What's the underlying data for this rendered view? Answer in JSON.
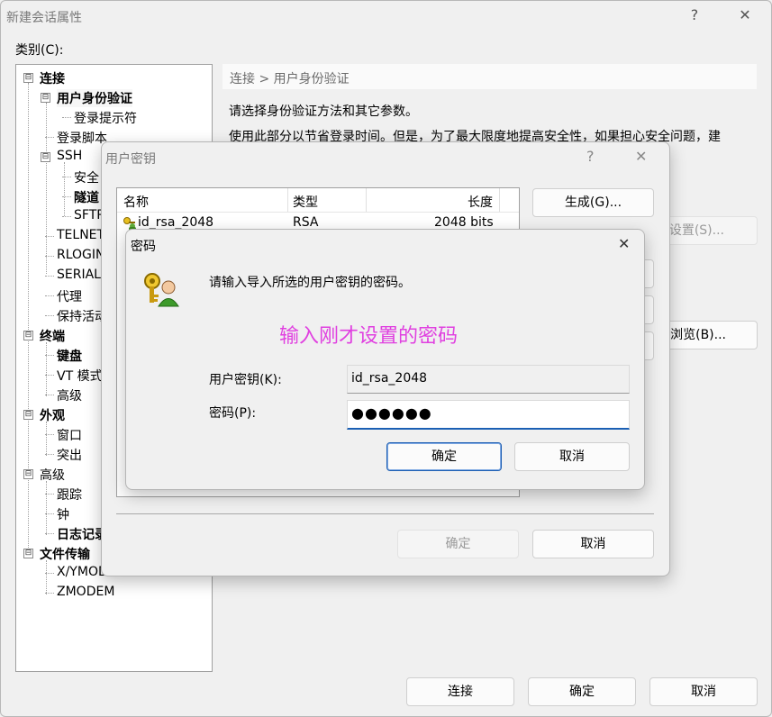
{
  "main_window": {
    "title": "新建会话属性",
    "help_glyph": "?",
    "close_glyph": "✕",
    "category_label": "类别(C):",
    "tree_items": [
      {
        "label": "连接",
        "bold": true,
        "expander": "⊟"
      },
      {
        "label": "用户身份验证",
        "bold": true,
        "expander": "⊟",
        "selected": true
      },
      {
        "label": "登录提示符",
        "bold": false
      },
      {
        "label": "登录脚本",
        "bold": false
      },
      {
        "label": "SSH",
        "bold": false,
        "expander": "⊟"
      },
      {
        "label": "安全",
        "bold": false
      },
      {
        "label": "隧道",
        "bold": true
      },
      {
        "label": "SFTP",
        "bold": false
      },
      {
        "label": "TELNET",
        "bold": false
      },
      {
        "label": "RLOGIN",
        "bold": false
      },
      {
        "label": "SERIAL",
        "bold": false
      },
      {
        "label": "代理",
        "bold": false
      },
      {
        "label": "保持活动",
        "bold": false
      },
      {
        "label": "终端",
        "bold": true,
        "expander": "⊟"
      },
      {
        "label": "键盘",
        "bold": true
      },
      {
        "label": "VT 模式",
        "bold": false
      },
      {
        "label": "高级",
        "bold": false
      },
      {
        "label": "外观",
        "bold": true,
        "expander": "⊟"
      },
      {
        "label": "窗口",
        "bold": false
      },
      {
        "label": "突出",
        "bold": false
      },
      {
        "label": "高级",
        "bold": false,
        "expander": "⊟"
      },
      {
        "label": "跟踪",
        "bold": false
      },
      {
        "label": "钟",
        "bold": false
      },
      {
        "label": "日志记录",
        "bold": true
      },
      {
        "label": "文件传输",
        "bold": true,
        "expander": "⊟"
      },
      {
        "label": "X/YMODEM",
        "bold": false
      },
      {
        "label": "ZMODEM",
        "bold": false
      }
    ],
    "section_header": "连接 > 用户身份验证",
    "desc_line1": "请选择身份验证方法和其它参数。",
    "desc_line2": "使用此部分以节省登录时间。但是，为了最大限度地提高安全性，如果担心安全问题，建",
    "settings_btn_partial": "设置(S)...",
    "browse_btn_partial": "浏览(B)...",
    "connect_btn": "连接",
    "ok_btn": "确定",
    "cancel_btn": "取消"
  },
  "user_key_dialog": {
    "title": "用户密钥",
    "help_glyph": "?",
    "close_glyph": "✕",
    "columns": [
      "名称",
      "类型",
      "长度"
    ],
    "rows": [
      {
        "name": "id_rsa_2048",
        "type": "RSA",
        "length": "2048 bits"
      }
    ],
    "generate_btn": "生成(G)...",
    "ok_btn": "确定",
    "cancel_btn": "取消"
  },
  "password_dialog": {
    "title": "密码",
    "close_glyph": "✕",
    "message": "请输入导入所选的用户密钥的密码。",
    "annotation": "输入刚才设置的密码",
    "annotation_color": "#e040e0",
    "user_key_label": "用户密钥(K):",
    "user_key_value": "id_rsa_2048",
    "password_label": "密码(P):",
    "password_value": "●●●●●●",
    "ok_btn": "确定",
    "cancel_btn": "取消"
  }
}
